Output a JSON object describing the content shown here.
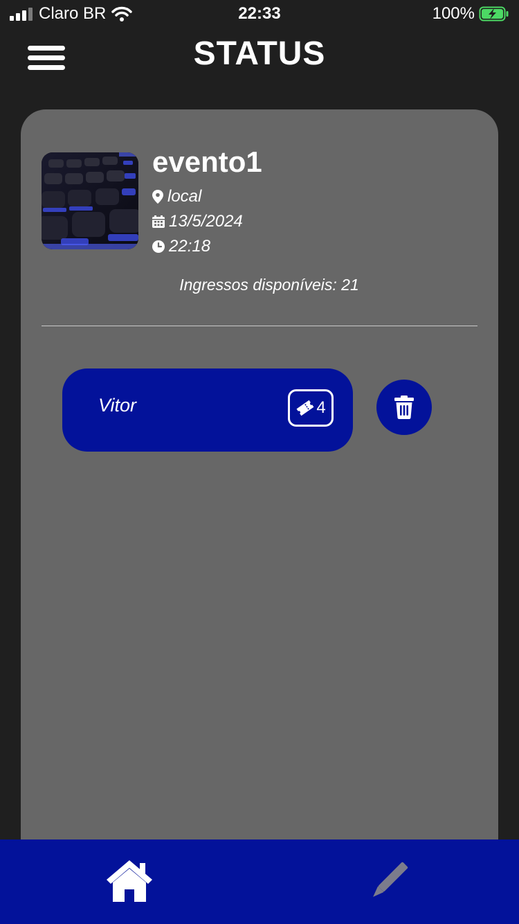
{
  "status_bar": {
    "carrier": "Claro BR",
    "time": "22:33",
    "battery": "100%"
  },
  "header": {
    "title": "STATUS",
    "menu_icon": "hamburger-menu-icon"
  },
  "event": {
    "name": "evento1",
    "location": "local",
    "date": "13/5/2024",
    "time": "22:18",
    "tickets_available": "Ingressos disponíveis: 21"
  },
  "guests": [
    {
      "name": "Vitor",
      "tickets": "4"
    }
  ],
  "bottom_nav": {
    "items": [
      {
        "icon": "home-icon"
      },
      {
        "icon": "pencil-icon"
      }
    ]
  },
  "colors": {
    "background": "#1f1f1f",
    "card": "#676767",
    "accent": "#03129a",
    "battery": "#4cd964"
  }
}
